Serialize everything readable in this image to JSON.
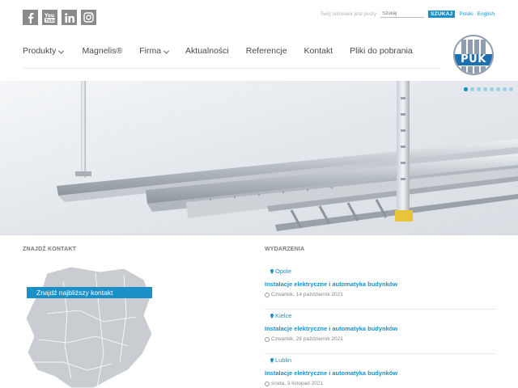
{
  "social": {
    "icons": [
      "facebook-icon",
      "youtube-icon",
      "linkedin-icon",
      "instagram-icon"
    ],
    "color": "#8a8a8a"
  },
  "header": {
    "clipboard_text": "Twój schowek jest pusty",
    "search_placeholder": "Szukaj",
    "search_button": "SZUKAJ",
    "lang_pl": "Polski",
    "lang_en": "English"
  },
  "nav": {
    "items": [
      {
        "label": "Produkty",
        "dropdown": true
      },
      {
        "label": "Magnelis®",
        "dropdown": false
      },
      {
        "label": "Firma",
        "dropdown": true
      },
      {
        "label": "Aktualności",
        "dropdown": false
      },
      {
        "label": "Referencje",
        "dropdown": false
      },
      {
        "label": "Kontakt",
        "dropdown": false
      },
      {
        "label": "Pliki do pobrania",
        "dropdown": false
      }
    ]
  },
  "logo": {
    "text": "PUK"
  },
  "hero": {
    "slides": 8,
    "active_slide": 1
  },
  "contact": {
    "title": "ZNAJDŹ KONTAKT",
    "banner": "Znajdź najbliższy kontakt"
  },
  "events": {
    "title": "WYDARZENIA",
    "items": [
      {
        "city": "Opole",
        "title": "Instalacje elektryczne i automatyka budynków",
        "date": "Czwartek, 14 październik 2021"
      },
      {
        "city": "Kielce",
        "title": "Instalacje elektryczne i automatyka budynków",
        "date": "Czwartek, 28 październik 2021"
      },
      {
        "city": "Lublin",
        "title": "Instalacje elektryczne i automatyka budynków",
        "date": "środa, 3 listopad 2021"
      }
    ]
  },
  "colors": {
    "accent": "#1c8fc7",
    "logo_blue": "#1d6fae",
    "logo_grey": "#8f9db0"
  }
}
